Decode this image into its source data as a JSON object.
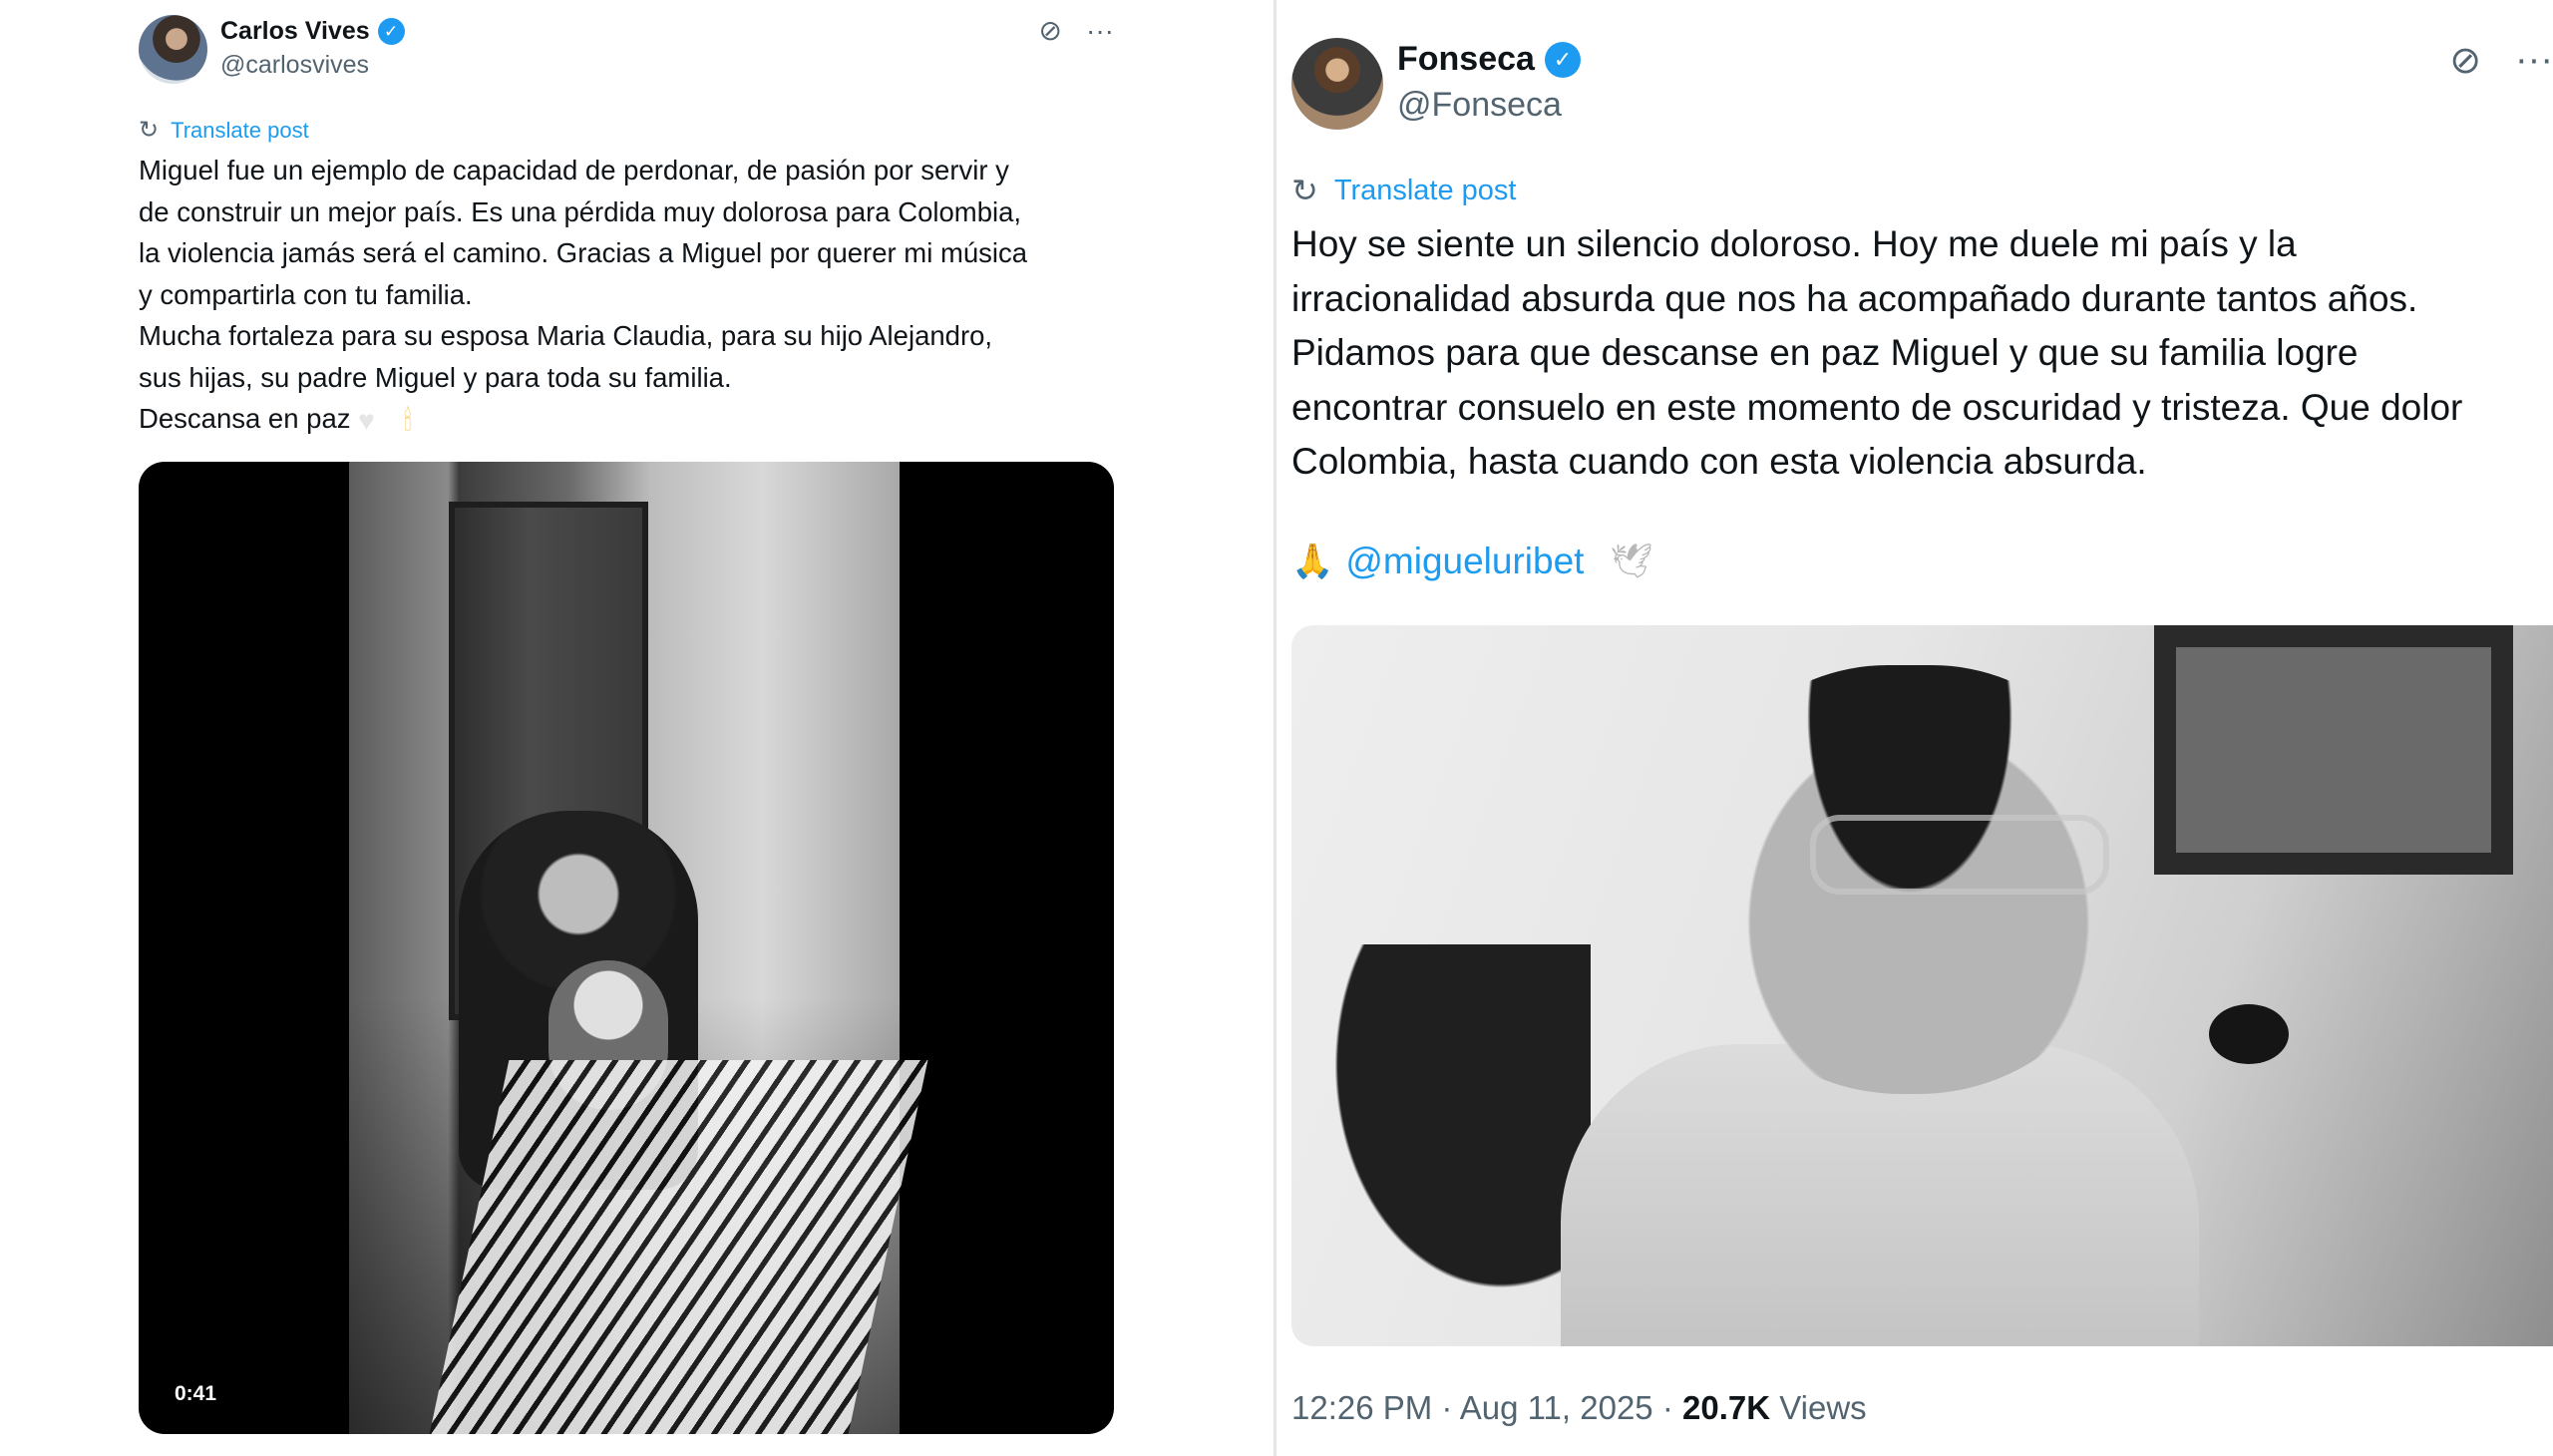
{
  "left_post": {
    "author_name": "Carlos Vives",
    "author_handle": "@carlosvives",
    "verified_icon": "✓",
    "grok_icon": "⊘",
    "more_icon": "···",
    "translate_label": "Translate post",
    "translate_icon": "↻",
    "body_lines": [
      "Miguel fue un ejemplo de capacidad de perdonar, de pasión por servir y",
      "de construir un mejor país. Es una pérdida muy dolorosa para Colombia,",
      "la violencia jamás será el camino. Gracias a Miguel por querer mi música",
      "y compartirla con tu familia.",
      "Mucha fortaleza para su esposa Maria Claudia, para su hijo Alejandro,",
      "sus hijas, su padre Miguel y para toda su familia."
    ],
    "closing_text": "Descansa en paz",
    "closing_emoji_heart": "♥",
    "closing_emoji_candle": "🕯",
    "video_duration": "0:41"
  },
  "right_post": {
    "author_name": "Fonseca",
    "author_handle": "@Fonseca",
    "verified_icon": "✓",
    "grok_icon": "⊘",
    "more_icon": "···",
    "translate_label": "Translate post",
    "translate_icon": "↻",
    "body_lines": [
      "Hoy se siente un silencio doloroso. Hoy me duele mi país y la",
      "irracionalidad absurda que nos ha acompañado durante tantos años.",
      "Pidamos para que descanse en paz Miguel y que su familia logre",
      "encontrar consuelo en este momento de oscuridad y tristeza. Que dolor",
      "Colombia, hasta cuando con esta violencia absurda."
    ],
    "mention_emoji_pray": "🙏",
    "mention_handle": "@migueluribet",
    "mention_emoji_dove": "🕊",
    "timestamp": "12:26 PM · Aug 11, 2025 · ",
    "views_count": "20.7K",
    "views_label": " Views"
  },
  "colors": {
    "accent": "#1d9bf0",
    "text_primary": "#0f1419",
    "text_secondary": "#536471"
  }
}
